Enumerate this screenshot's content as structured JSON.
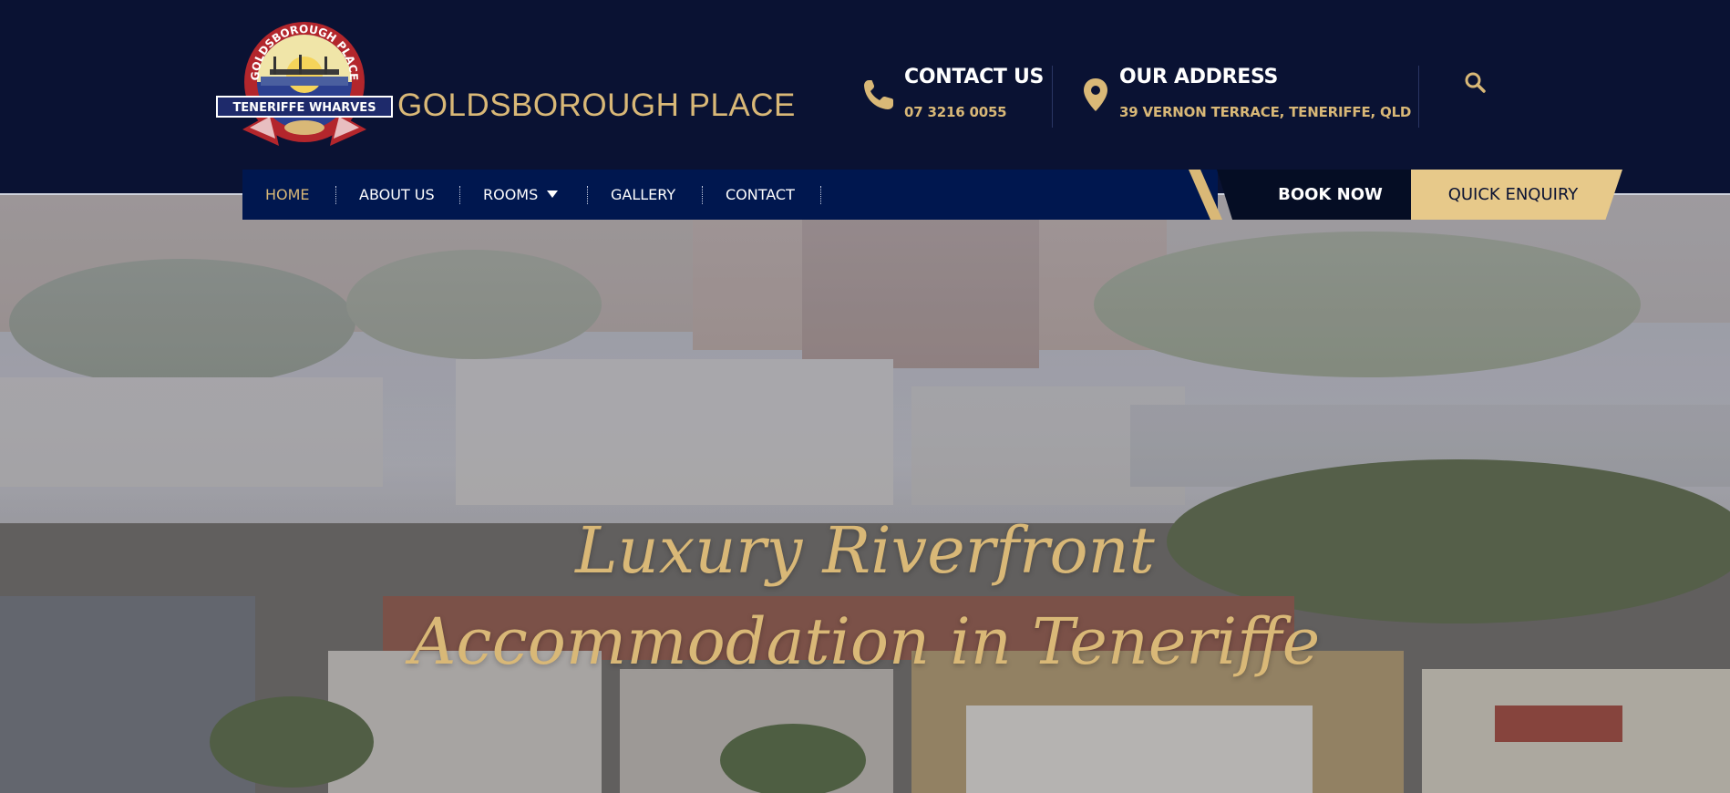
{
  "brand": {
    "name": "GOLDSBOROUGH PLACE",
    "logo_top_text": "GOLDSBOROUGH PLACE",
    "logo_banner_text": "TENERIFFE WHARVES"
  },
  "contact": {
    "title": "CONTACT US",
    "phone": "07 3216 0055",
    "icon": "phone-icon"
  },
  "address": {
    "title": "OUR ADDRESS",
    "text": "39 VERNON TERRACE, TENERIFFE, QLD",
    "icon": "map-pin-icon"
  },
  "search": {
    "icon": "search-icon"
  },
  "nav": {
    "items": [
      {
        "label": "HOME",
        "active": true
      },
      {
        "label": "ABOUT US"
      },
      {
        "label": "ROOMS",
        "has_dropdown": true
      },
      {
        "label": "GALLERY"
      },
      {
        "label": "CONTACT"
      }
    ]
  },
  "cta": {
    "book_now": "BOOK NOW",
    "quick_enquiry": "QUICK ENQUIRY"
  },
  "hero": {
    "line1": "Luxury Riverfront",
    "line2": "Accommodation in Teneriffe"
  },
  "colors": {
    "header_bg": "#0a1233",
    "nav_bg": "#00174f",
    "accent_gold": "#d9b877",
    "book_bg": "#050d24",
    "enquiry_bg": "#e7c98a"
  }
}
